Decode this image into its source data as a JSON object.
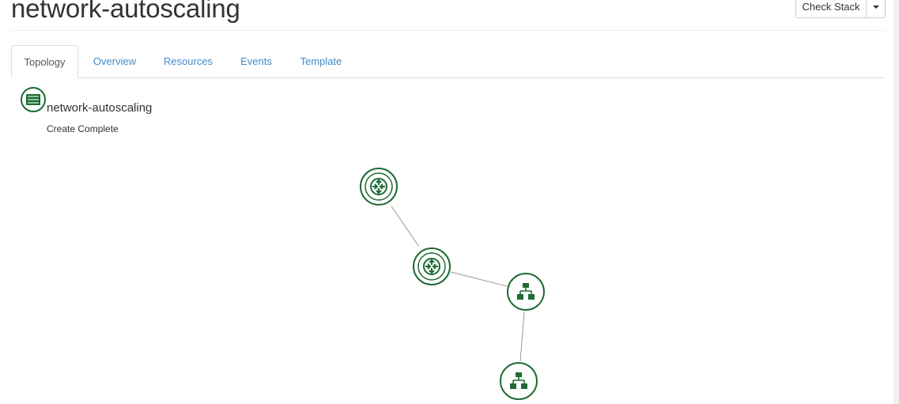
{
  "header": {
    "title": "network-autoscaling",
    "check_stack_label": "Check Stack"
  },
  "tabs": [
    {
      "label": "Topology",
      "active": true
    },
    {
      "label": "Overview",
      "active": false
    },
    {
      "label": "Resources",
      "active": false
    },
    {
      "label": "Events",
      "active": false
    },
    {
      "label": "Template",
      "active": false
    }
  ],
  "stack": {
    "name": "network-autoscaling",
    "status": "Create Complete",
    "icon": "stack-server-icon"
  },
  "topology": {
    "nodes": [
      {
        "id": "router-1",
        "icon": "router-icon"
      },
      {
        "id": "router-2",
        "icon": "router-icon"
      },
      {
        "id": "network-1",
        "icon": "network-icon"
      },
      {
        "id": "network-2",
        "icon": "network-icon"
      }
    ],
    "links": [
      [
        "router-1",
        "router-2"
      ],
      [
        "router-2",
        "network-1"
      ],
      [
        "network-1",
        "network-2"
      ]
    ]
  },
  "colors": {
    "node": "#1e6b35",
    "link": "#999999",
    "tab_link": "#428bca"
  }
}
